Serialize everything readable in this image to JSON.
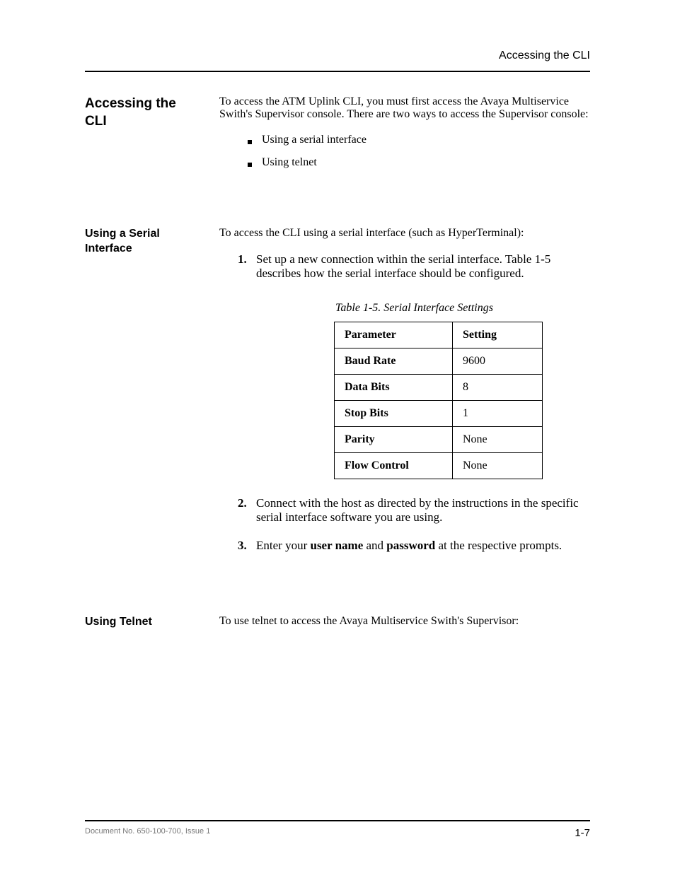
{
  "meta": {
    "running_head": "Accessing the CLI",
    "page_number": "1-7",
    "footer_left": "Document No. 650-100-700, Issue 1"
  },
  "s1": {
    "heading": "Accessing the CLI",
    "intro": "To access the ATM Uplink CLI, you must first access the Avaya Multiservice Swith's Supervisor console. There are two ways to access the Supervisor console:",
    "bullets": [
      "Using a serial interface",
      "Using telnet"
    ]
  },
  "s2": {
    "heading": "Using a Serial Interface",
    "intro": "To access the CLI using a serial interface (such as HyperTerminal):",
    "step1": "Set up a new connection within the serial interface. Table 1-5 describes how the serial interface should be configured.",
    "table_caption": "Table 1-5.  Serial Interface Settings",
    "table": {
      "headers": [
        "Parameter",
        "Setting"
      ],
      "rows": [
        {
          "param": "Baud Rate",
          "setting": "9600"
        },
        {
          "param": "Data Bits",
          "setting": "8"
        },
        {
          "param": "Stop Bits",
          "setting": "1"
        },
        {
          "param": "Parity",
          "setting": "None"
        },
        {
          "param": "Flow Control",
          "setting": "None"
        }
      ]
    },
    "step2": "Connect with the host as directed by the instructions in the specific serial interface software you are using.",
    "step3_a": "Enter your ",
    "step3_b": "user name",
    "step3_c": " and ",
    "step3_d": "password",
    "step3_e": " at the respective prompts."
  },
  "s3": {
    "heading": "Using Telnet",
    "intro": "To use telnet to access the Avaya Multiservice Swith's Supervisor:"
  }
}
